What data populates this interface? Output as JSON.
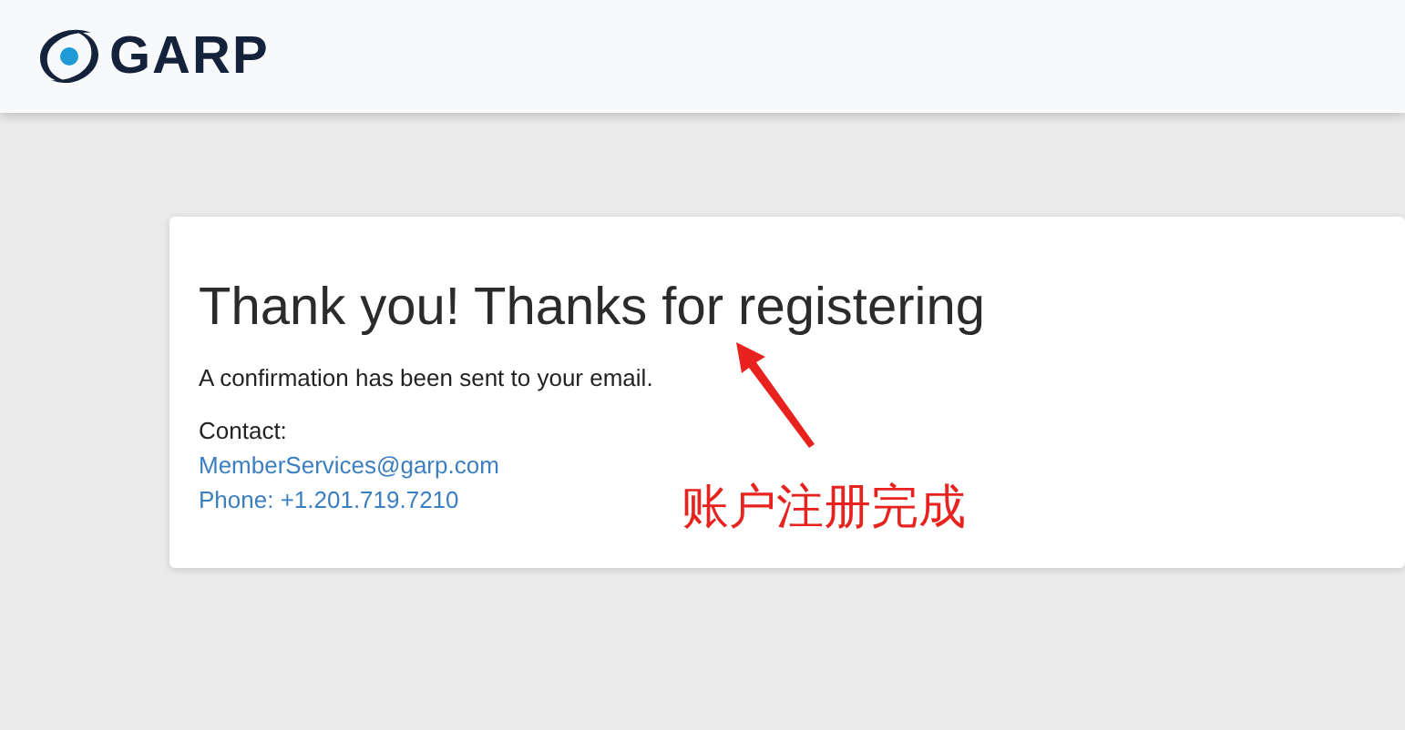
{
  "header": {
    "logo_text": "GARP"
  },
  "card": {
    "heading": "Thank you! Thanks for registering",
    "message": "A confirmation has been sent to your email.",
    "contact_label": "Contact:",
    "email": "MemberServices@garp.com",
    "phone": "Phone: +1.201.719.7210"
  },
  "annotation": {
    "text": "账户注册完成"
  }
}
